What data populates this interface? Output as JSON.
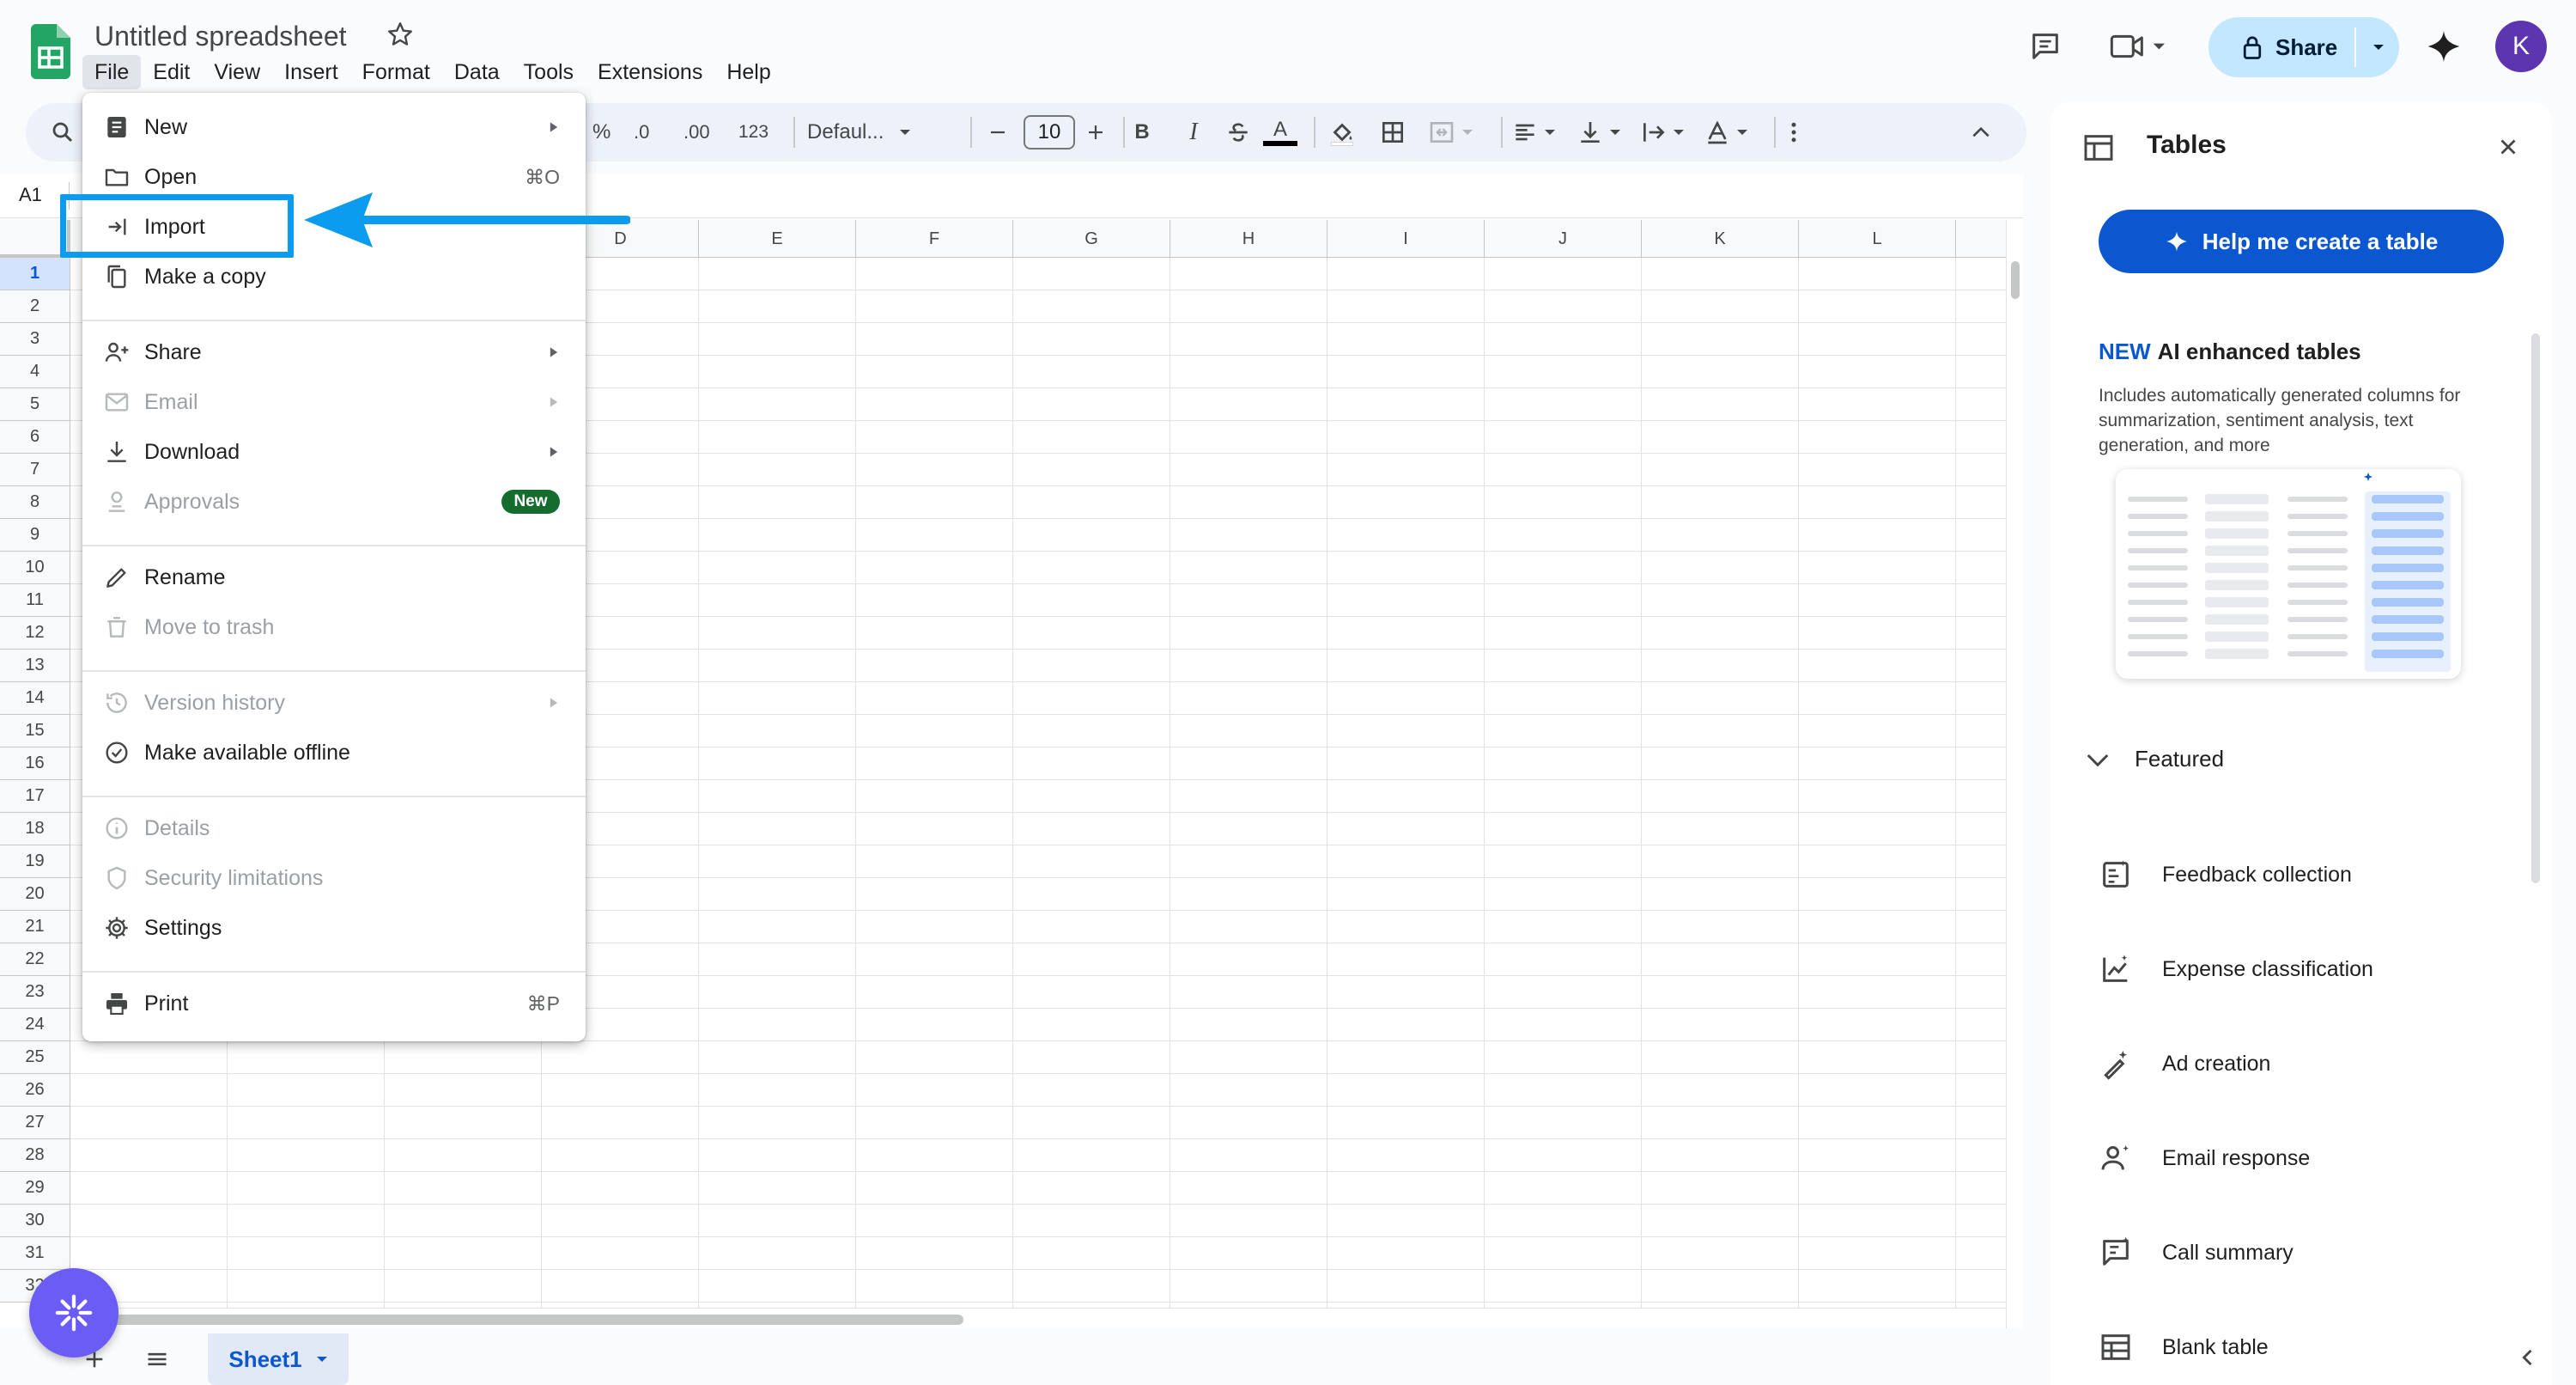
{
  "doc": {
    "title": "Untitled spreadsheet"
  },
  "menubar": [
    "File",
    "Edit",
    "View",
    "Insert",
    "Format",
    "Data",
    "Tools",
    "Extensions",
    "Help"
  ],
  "header": {
    "share_label": "Share",
    "avatar_letter": "K"
  },
  "toolbar": {
    "percent": "%",
    "decimal_decrease": ".0",
    "decimal_increase": ".00",
    "number_format": "123",
    "font_name": "Defaul...",
    "font_size": "10",
    "bold": "B",
    "italic": "I",
    "text_color_letter": "A"
  },
  "namebox": "A1",
  "grid": {
    "columns": [
      "D",
      "E",
      "F",
      "G",
      "H",
      "I",
      "J",
      "K",
      "L"
    ],
    "rows": [
      "1",
      "2",
      "3",
      "4",
      "5",
      "6",
      "7",
      "8",
      "9",
      "10",
      "11",
      "12",
      "13",
      "14",
      "15",
      "16",
      "17",
      "18",
      "19",
      "20",
      "21",
      "22",
      "23",
      "24",
      "25",
      "26",
      "27",
      "28",
      "29",
      "30",
      "31",
      "32"
    ],
    "selected_row": "1"
  },
  "file_menu": {
    "items": [
      {
        "label": "New",
        "icon": "sheet-add-icon",
        "submenu": true
      },
      {
        "label": "Open",
        "icon": "folder-icon",
        "shortcut": "⌘O"
      },
      {
        "label": "Import",
        "icon": "import-icon"
      },
      {
        "label": "Make a copy",
        "icon": "copy-icon"
      },
      {
        "label": "Share",
        "icon": "person-add-icon",
        "submenu": true
      },
      {
        "label": "Email",
        "icon": "email-icon",
        "submenu": true,
        "disabled": true
      },
      {
        "label": "Download",
        "icon": "download-icon",
        "submenu": true
      },
      {
        "label": "Approvals",
        "icon": "approvals-icon",
        "disabled": true,
        "badge": "New"
      },
      {
        "label": "Rename",
        "icon": "pencil-icon"
      },
      {
        "label": "Move to trash",
        "icon": "trash-icon",
        "disabled": true
      },
      {
        "label": "Version history",
        "icon": "history-icon",
        "submenu": true,
        "disabled": true
      },
      {
        "label": "Make available offline",
        "icon": "offline-icon"
      },
      {
        "label": "Details",
        "icon": "info-icon",
        "disabled": true
      },
      {
        "label": "Security limitations",
        "icon": "shield-icon",
        "disabled": true
      },
      {
        "label": "Settings",
        "icon": "gear-icon"
      },
      {
        "label": "Print",
        "icon": "printer-icon",
        "shortcut": "⌘P"
      }
    ]
  },
  "side_panel": {
    "title": "Tables",
    "help_button": "Help me create a table",
    "ai_new": "NEW",
    "ai_title": "AI enhanced tables",
    "ai_description": "Includes automatically generated columns for summarization, sentiment analysis, text generation, and more",
    "featured_label": "Featured",
    "templates": [
      {
        "label": "Feedback collection",
        "icon": "feedback-list-icon"
      },
      {
        "label": "Expense classification",
        "icon": "chart-sparkle-icon"
      },
      {
        "label": "Ad creation",
        "icon": "magic-pen-icon"
      },
      {
        "label": "Email response",
        "icon": "person-sparkle-icon"
      },
      {
        "label": "Call summary",
        "icon": "list-sparkle-icon"
      },
      {
        "label": "Blank table",
        "icon": "table-icon"
      }
    ]
  },
  "sheets": {
    "active": "Sheet1"
  },
  "colors": {
    "accent_blue": "#0b57d0",
    "share_bg": "#c2e7ff",
    "highlight_annotation": "#0b9cf0",
    "new_badge": "#146c2e"
  }
}
